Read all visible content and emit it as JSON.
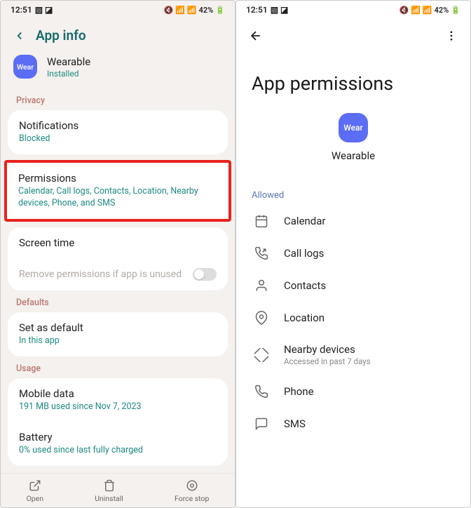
{
  "status": {
    "time": "12:51",
    "battery": "42%"
  },
  "left": {
    "header": "App info",
    "app": {
      "iconText": "Wear",
      "name": "Wearable",
      "status": "Installed"
    },
    "sections": {
      "privacy": "Privacy",
      "defaults": "Defaults",
      "usage": "Usage"
    },
    "notifications": {
      "title": "Notifications",
      "sub": "Blocked"
    },
    "permissions": {
      "title": "Permissions",
      "sub": "Calendar, Call logs, Contacts, Location, Nearby devices, Phone, and SMS"
    },
    "screenTime": {
      "title": "Screen time"
    },
    "removePerms": "Remove permissions if app is unused",
    "setDefault": {
      "title": "Set as default",
      "sub": "In this app"
    },
    "mobileData": {
      "title": "Mobile data",
      "sub": "191 MB used since Nov 7, 2023"
    },
    "battery": {
      "title": "Battery",
      "sub": "0% used since last fully charged"
    },
    "bottom": {
      "open": "Open",
      "uninstall": "Uninstall",
      "forceStop": "Force stop"
    }
  },
  "right": {
    "title": "App permissions",
    "app": {
      "iconText": "Wear",
      "name": "Wearable"
    },
    "allowed": "Allowed",
    "perms": {
      "calendar": "Calendar",
      "callLogs": "Call logs",
      "contacts": "Contacts",
      "location": "Location",
      "nearby": {
        "name": "Nearby devices",
        "sub": "Accessed in past 7 days"
      },
      "phone": "Phone",
      "sms": "SMS"
    }
  }
}
